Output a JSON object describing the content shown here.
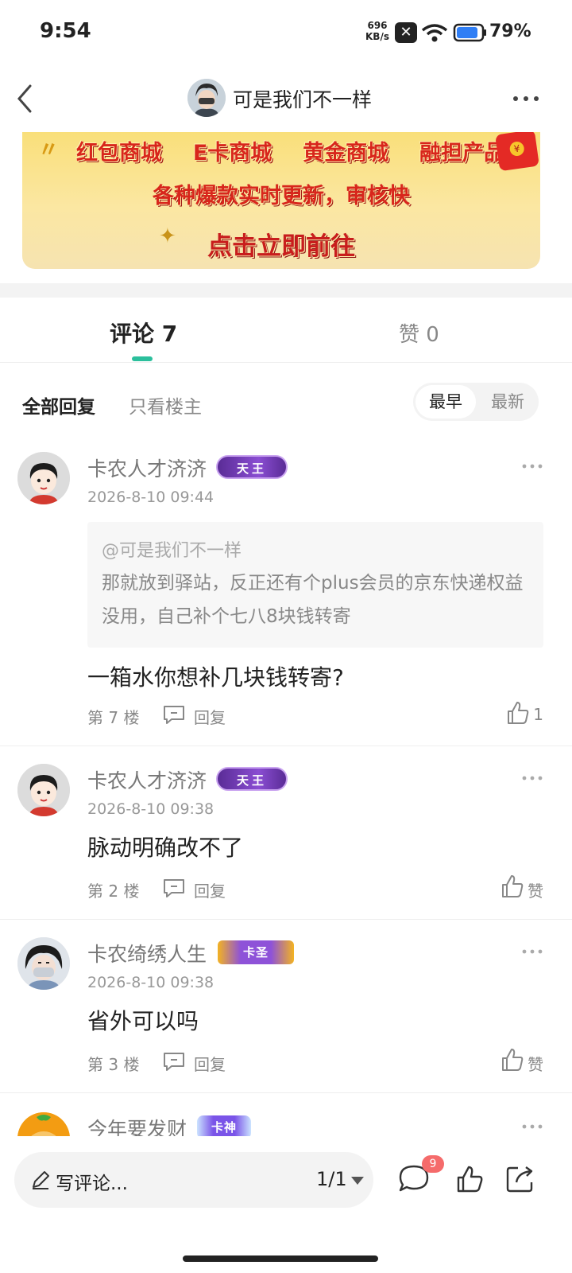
{
  "status_bar": {
    "time": "9:54",
    "net_rate_value": "696",
    "net_rate_unit": "KB/s",
    "battery_pct": "79%",
    "battery_level": 0.79
  },
  "header": {
    "title": "可是我们不一样"
  },
  "banner": {
    "links": [
      "红包商城",
      "E卡商城",
      "黄金商城",
      "融担产品"
    ],
    "subtitle": "各种爆款实时更新，审核快",
    "cta": "点击立即前往"
  },
  "tabs": {
    "comments": "评论 7",
    "likes": "赞 0"
  },
  "filters": {
    "all": "全部回复",
    "op_only": "只看楼主",
    "sort_earliest": "最早",
    "sort_latest": "最新"
  },
  "comments": [
    {
      "user": "卡农人才济济",
      "badge": "天王",
      "date": "2026-8-10 09:44",
      "quote": {
        "name": "@可是我们不一样",
        "text": "那就放到驿站，反正还有个plus会员的京东快递权益没用，自己补个七八8块钱转寄"
      },
      "text": "一箱水你想补几块钱转寄?",
      "floor": "第 7 楼",
      "reply": "回复",
      "like": "1"
    },
    {
      "user": "卡农人才济济",
      "badge": "天王",
      "date": "2026-8-10 09:38",
      "text": "脉动明确改不了",
      "floor": "第 2 楼",
      "reply": "回复",
      "like": "赞"
    },
    {
      "user": "卡农绮绣人生",
      "badge": "卡圣",
      "date": "2026-8-10 09:38",
      "text": "省外可以吗",
      "floor": "第 3 楼",
      "reply": "回复",
      "like": "赞"
    },
    {
      "user": "今年要发财",
      "badge": "卡神"
    }
  ],
  "bottom_bar": {
    "placeholder": "写评论...",
    "page": "1/1",
    "comment_count": "9"
  },
  "colors": {
    "accent": "#2bbf9c",
    "badge_red": "#f56b6b",
    "banner_text": "#d8261c"
  }
}
